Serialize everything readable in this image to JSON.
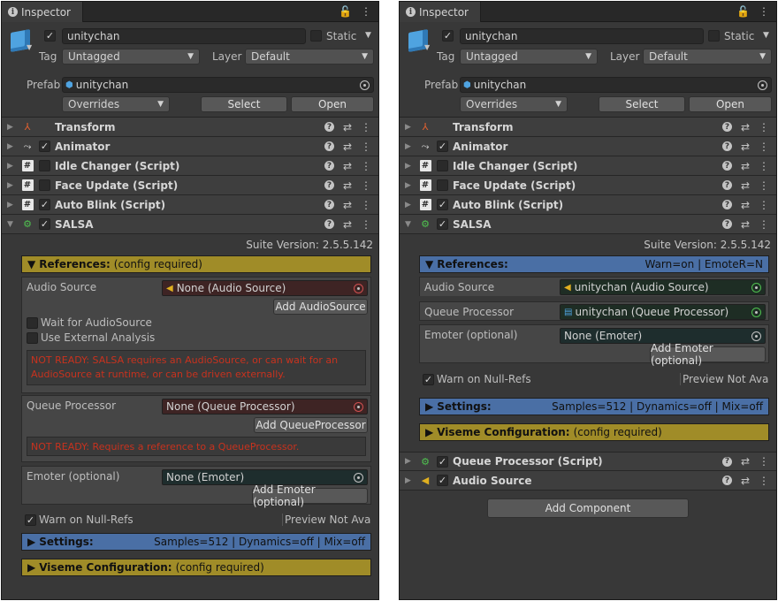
{
  "left": {
    "tab_title": "Inspector",
    "object_name": "unitychan",
    "static_label": "Static",
    "tag_label": "Tag",
    "tag_value": "Untagged",
    "layer_label": "Layer",
    "layer_value": "Default",
    "prefab_label": "Prefab",
    "prefab_value": "unitychan",
    "overrides_label": "Overrides",
    "select_label": "Select",
    "open_label": "Open",
    "components": [
      "Transform",
      "Animator",
      "Idle Changer (Script)",
      "Face Update (Script)",
      "Auto Blink (Script)",
      "SALSA"
    ],
    "suite_version": "Suite Version: 2.5.5.142",
    "references_title": "References:",
    "references_sub": "(config required)",
    "audio_source_label": "Audio Source",
    "audio_source_value": "None (Audio Source)",
    "add_audiosource": "Add AudioSource",
    "wait_for_audiosource": "Wait for AudioSource",
    "use_external_analysis": "Use External Analysis",
    "error_audio": "NOT READY: SALSA requires an AudioSource, or can wait for an AudioSource at runtime, or can be driven externally.",
    "queue_processor_label": "Queue Processor",
    "queue_processor_value": "None (Queue Processor)",
    "add_queueprocessor": "Add QueueProcessor",
    "error_queue": "NOT READY: Requires a reference to a QueueProcessor.",
    "emoter_label": "Emoter (optional)",
    "emoter_value": "None (Emoter)",
    "add_emoter": "Add Emoter (optional)",
    "warn_null_refs": "Warn on Null-Refs",
    "preview_label": "Preview Not Avai",
    "settings_title": "Settings:",
    "settings_sub": "Samples=512 | Dynamics=off | Mix=off",
    "viseme_title": "Viseme Configuration:",
    "viseme_sub": "(config required)"
  },
  "right": {
    "tab_title": "Inspector",
    "object_name": "unitychan",
    "static_label": "Static",
    "tag_label": "Tag",
    "tag_value": "Untagged",
    "layer_label": "Layer",
    "layer_value": "Default",
    "prefab_label": "Prefab",
    "prefab_value": "unitychan",
    "overrides_label": "Overrides",
    "select_label": "Select",
    "open_label": "Open",
    "components": [
      "Transform",
      "Animator",
      "Idle Changer (Script)",
      "Face Update (Script)",
      "Auto Blink (Script)",
      "SALSA"
    ],
    "suite_version": "Suite Version: 2.5.5.142",
    "references_title": "References:",
    "references_sub": "Warn=on | EmoteR=N",
    "audio_source_label": "Audio Source",
    "audio_source_value": "unitychan (Audio Source)",
    "queue_processor_label": "Queue Processor",
    "queue_processor_value": "unitychan (Queue Processor)",
    "emoter_label": "Emoter (optional)",
    "emoter_value": "None (Emoter)",
    "add_emoter": "Add Emoter (optional)",
    "warn_null_refs": "Warn on Null-Refs",
    "preview_label": "Preview Not Avai",
    "settings_title": "Settings:",
    "settings_sub": "Samples=512 | Dynamics=off | Mix=off",
    "viseme_title": "Viseme Configuration:",
    "viseme_sub": "(config required)",
    "extra_components": [
      "Queue Processor (Script)",
      "Audio Source"
    ],
    "add_component": "Add Component"
  }
}
